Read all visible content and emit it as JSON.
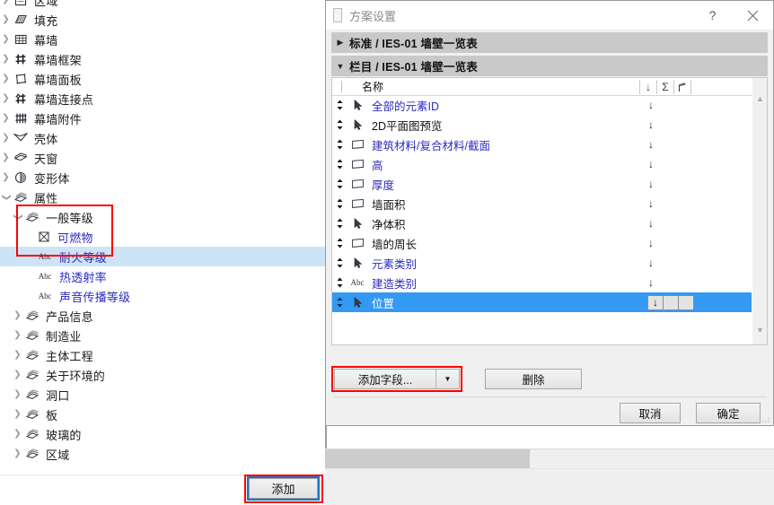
{
  "left_panel": {
    "tree_items": [
      {
        "label": "区域",
        "icon": "zone-icon",
        "twisty": "collapsed",
        "indent": 0,
        "color": "black",
        "selected": false
      },
      {
        "label": "填充",
        "icon": "fill-icon",
        "twisty": "collapsed",
        "indent": 0,
        "color": "black",
        "selected": false
      },
      {
        "label": "幕墙",
        "icon": "curtain-wall-icon",
        "twisty": "collapsed",
        "indent": 0,
        "color": "black",
        "selected": false
      },
      {
        "label": "幕墙框架",
        "icon": "curtain-wall-frame-icon",
        "twisty": "collapsed",
        "indent": 0,
        "color": "black",
        "selected": false
      },
      {
        "label": "幕墙面板",
        "icon": "curtain-wall-panel-icon",
        "twisty": "collapsed",
        "indent": 0,
        "color": "black",
        "selected": false
      },
      {
        "label": "幕墙连接点",
        "icon": "curtain-wall-junction-icon",
        "twisty": "collapsed",
        "indent": 0,
        "color": "black",
        "selected": false
      },
      {
        "label": "幕墙附件",
        "icon": "curtain-wall-accessory-icon",
        "twisty": "collapsed",
        "indent": 0,
        "color": "black",
        "selected": false
      },
      {
        "label": "壳体",
        "icon": "shell-icon",
        "twisty": "collapsed",
        "indent": 0,
        "color": "black",
        "selected": false
      },
      {
        "label": "天窗",
        "icon": "skylight-icon",
        "twisty": "collapsed",
        "indent": 0,
        "color": "black",
        "selected": false
      },
      {
        "label": "变形体",
        "icon": "morph-icon",
        "twisty": "collapsed",
        "indent": 0,
        "color": "black",
        "selected": false
      },
      {
        "label": "属性",
        "icon": "property-icon",
        "twisty": "expanded",
        "indent": 0,
        "color": "black",
        "selected": false
      },
      {
        "label": "一般等级",
        "icon": "property-icon",
        "twisty": "expanded",
        "indent": 1,
        "color": "black",
        "selected": false
      },
      {
        "label": "可燃物",
        "icon": "checkbox-x-icon",
        "twisty": "none",
        "indent": 2,
        "color": "blue",
        "selected": false
      },
      {
        "label": "耐火等级",
        "icon": "abc-icon",
        "twisty": "none",
        "indent": 2,
        "color": "blue",
        "selected": true
      },
      {
        "label": "热透射率",
        "icon": "abc-icon",
        "twisty": "none",
        "indent": 2,
        "color": "blue",
        "selected": false
      },
      {
        "label": "声音传播等级",
        "icon": "abc-icon",
        "twisty": "none",
        "indent": 2,
        "color": "blue",
        "selected": false
      },
      {
        "label": "产品信息",
        "icon": "property-icon",
        "twisty": "collapsed",
        "indent": 1,
        "color": "black",
        "selected": false
      },
      {
        "label": "制造业",
        "icon": "property-icon",
        "twisty": "collapsed",
        "indent": 1,
        "color": "black",
        "selected": false
      },
      {
        "label": "主体工程",
        "icon": "property-icon",
        "twisty": "collapsed",
        "indent": 1,
        "color": "black",
        "selected": false
      },
      {
        "label": "关于环境的",
        "icon": "property-icon",
        "twisty": "collapsed",
        "indent": 1,
        "color": "black",
        "selected": false
      },
      {
        "label": "洞口",
        "icon": "property-icon",
        "twisty": "collapsed",
        "indent": 1,
        "color": "black",
        "selected": false
      },
      {
        "label": "板",
        "icon": "property-icon",
        "twisty": "collapsed",
        "indent": 1,
        "color": "black",
        "selected": false
      },
      {
        "label": "玻璃的",
        "icon": "property-icon",
        "twisty": "collapsed",
        "indent": 1,
        "color": "black",
        "selected": false
      },
      {
        "label": "区域",
        "icon": "property-icon",
        "twisty": "collapsed",
        "indent": 1,
        "color": "black",
        "selected": false
      }
    ],
    "add_button_label": "添加"
  },
  "dialog": {
    "title": "方案设置",
    "help_label": "?",
    "close_label": "✕",
    "sections": [
      {
        "title": "标准 / IES-01 墙壁一览表",
        "expanded": false
      },
      {
        "title": "栏目 / IES-01 墙壁一览表",
        "expanded": true
      }
    ],
    "list": {
      "header": {
        "name_column": "名称",
        "icons": [
          "sort-descending-icon",
          "sum-icon",
          "flag-icon"
        ]
      },
      "rows": [
        {
          "label": "全部的元素ID",
          "icon": "arrow-pointer-icon",
          "color": "blue",
          "sort": "↓",
          "selected": false
        },
        {
          "label": "2D平面图预览",
          "icon": "arrow-pointer-icon",
          "color": "black",
          "sort": "↓",
          "selected": false
        },
        {
          "label": "建筑材料/复合材料/截面",
          "icon": "panel-icon",
          "color": "blue",
          "sort": "↓",
          "selected": false
        },
        {
          "label": "高",
          "icon": "panel-icon",
          "color": "blue",
          "sort": "↓",
          "selected": false
        },
        {
          "label": "厚度",
          "icon": "panel-icon",
          "color": "blue",
          "sort": "↓",
          "selected": false
        },
        {
          "label": "墙面积",
          "icon": "panel-icon",
          "color": "black",
          "sort": "↓",
          "selected": false
        },
        {
          "label": "净体积",
          "icon": "arrow-pointer-icon",
          "color": "black",
          "sort": "↓",
          "selected": false
        },
        {
          "label": "墙的周长",
          "icon": "panel-icon",
          "color": "black",
          "sort": "↓",
          "selected": false
        },
        {
          "label": "元素类别",
          "icon": "arrow-pointer-icon",
          "color": "blue",
          "sort": "↓",
          "selected": false
        },
        {
          "label": "建造类别",
          "icon": "abc-icon",
          "color": "blue",
          "sort": "↓",
          "selected": false
        },
        {
          "label": "位置",
          "icon": "arrow-pointer-icon",
          "color": "blue",
          "sort": "↓",
          "selected": true
        }
      ]
    },
    "buttons": {
      "add_field": "添加字段...",
      "add_field_dropdown": "▼",
      "delete": "删除",
      "cancel": "取消",
      "ok": "确定"
    }
  },
  "colors": {
    "selection_blue": "#3399f3",
    "tree_selection": "#cde4f7",
    "highlight_red": "#ff0000",
    "focus_blue": "#1a73c8",
    "link_blue": "#2b2bc0",
    "section_gray": "#c9c9c9"
  }
}
